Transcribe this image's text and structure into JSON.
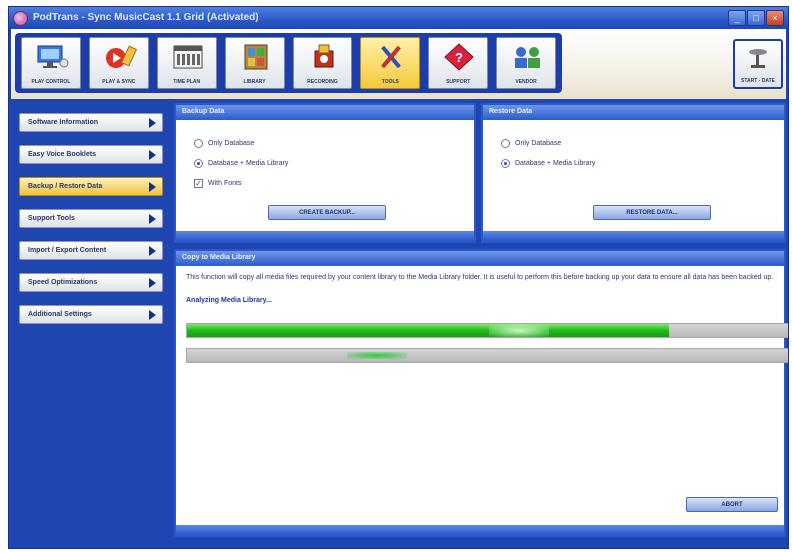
{
  "window": {
    "title": "PodTrans - Sync MusicCast 1.1 Grid (Activated)"
  },
  "toolbar": {
    "buttons": [
      {
        "label": "PLAY CONTROL",
        "icon": "monitor-icon",
        "active": false
      },
      {
        "label": "PLAY & SYNC",
        "icon": "play-sync-icon",
        "active": false
      },
      {
        "label": "TIME PLAN",
        "icon": "calendar-icon",
        "active": false
      },
      {
        "label": "LIBRARY",
        "icon": "library-icon",
        "active": false
      },
      {
        "label": "RECORDING",
        "icon": "recording-icon",
        "active": false
      },
      {
        "label": "TOOLS",
        "icon": "tools-icon",
        "active": true
      },
      {
        "label": "SUPPORT",
        "icon": "support-icon",
        "active": false
      },
      {
        "label": "VENDOR",
        "icon": "vendor-icon",
        "active": false
      }
    ],
    "start_label": "START - DATE"
  },
  "sidebar": {
    "items": [
      {
        "label": "Software Information",
        "active": false
      },
      {
        "label": "Easy Voice Booklets",
        "active": false
      },
      {
        "label": "Backup / Restore Data",
        "active": true
      },
      {
        "label": "Support Tools",
        "active": false
      },
      {
        "label": "Import / Export Content",
        "active": false
      },
      {
        "label": "Speed Optimizations",
        "active": false
      },
      {
        "label": "Additional Settings",
        "active": false
      }
    ]
  },
  "backup": {
    "title": "Backup Data",
    "options": [
      "Only Database",
      "Database + Media Library"
    ],
    "selected": 1,
    "checkbox_label": "With Fonts",
    "checked": true,
    "button": "CREATE BACKUP..."
  },
  "restore": {
    "title": "Restore Data",
    "options": [
      "Only Database",
      "Database + Media Library"
    ],
    "selected": 1,
    "button": "RESTORE DATA..."
  },
  "copy": {
    "title": "Copy to Media Library",
    "description": "This function will copy all media files required by your content library to the Media Library folder. It is useful to perform this before backing up your data to ensure all data has been backed up.",
    "status": "Analyzing Media Library...",
    "progress": 0.8,
    "button": "ABORT"
  },
  "colors": {
    "frame": "#1f45b0",
    "highlight": "#f0c040",
    "progress": "#1fb81a"
  }
}
